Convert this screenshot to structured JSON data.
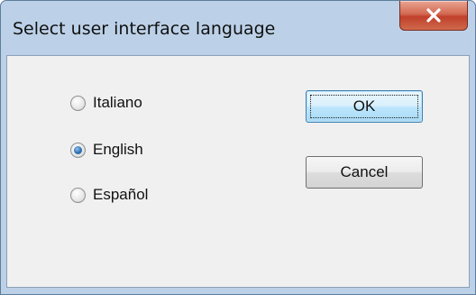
{
  "window": {
    "title": "Select user interface language"
  },
  "languages": [
    {
      "label": "Italiano",
      "checked": false
    },
    {
      "label": "English",
      "checked": true
    },
    {
      "label": "Español",
      "checked": false
    }
  ],
  "buttons": {
    "ok_label": "OK",
    "cancel_label": "Cancel"
  },
  "colors": {
    "titlebar": "#bcd1e8",
    "close_button": "#c0402b",
    "client_background": "#f0f0f0",
    "selected_radio": "#2f6fb0"
  }
}
